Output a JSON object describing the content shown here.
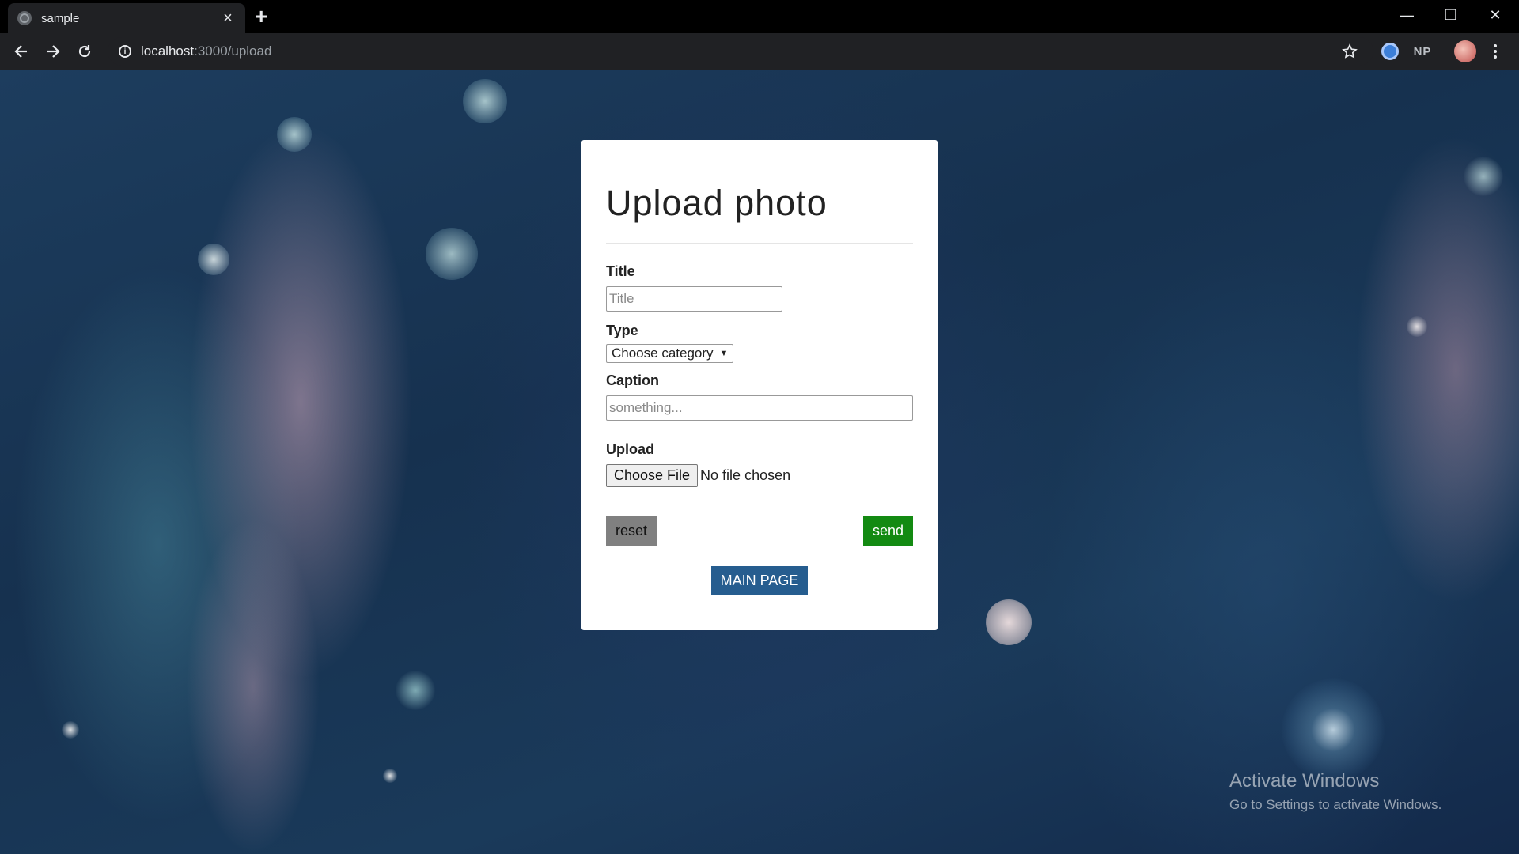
{
  "browser": {
    "tab_title": "sample",
    "new_tab_symbol": "+",
    "url_host": "localhost",
    "url_path": ":3000/upload",
    "extension_text": "NP",
    "window_controls": {
      "minimize": "—",
      "restore": "❐",
      "close": "✕"
    }
  },
  "form": {
    "heading": "Upload photo",
    "title": {
      "label": "Title",
      "placeholder": "Title"
    },
    "type": {
      "label": "Type",
      "selected": "Choose category"
    },
    "caption": {
      "label": "Caption",
      "placeholder": "something..."
    },
    "upload": {
      "label": "Upload",
      "button": "Choose File",
      "status": "No file chosen"
    },
    "reset_label": "reset",
    "send_label": "send",
    "main_page_label": "MAIN PAGE"
  },
  "watermark": {
    "title": "Activate Windows",
    "subtitle": "Go to Settings to activate Windows."
  },
  "colors": {
    "send_button": "#138a12",
    "reset_button": "#808080",
    "main_page_button": "#265d8f",
    "chrome_dark": "#202124"
  },
  "icons": [
    "back-arrow-icon",
    "forward-arrow-icon",
    "reload-icon",
    "info-icon",
    "star-icon",
    "kebab-menu-icon"
  ]
}
